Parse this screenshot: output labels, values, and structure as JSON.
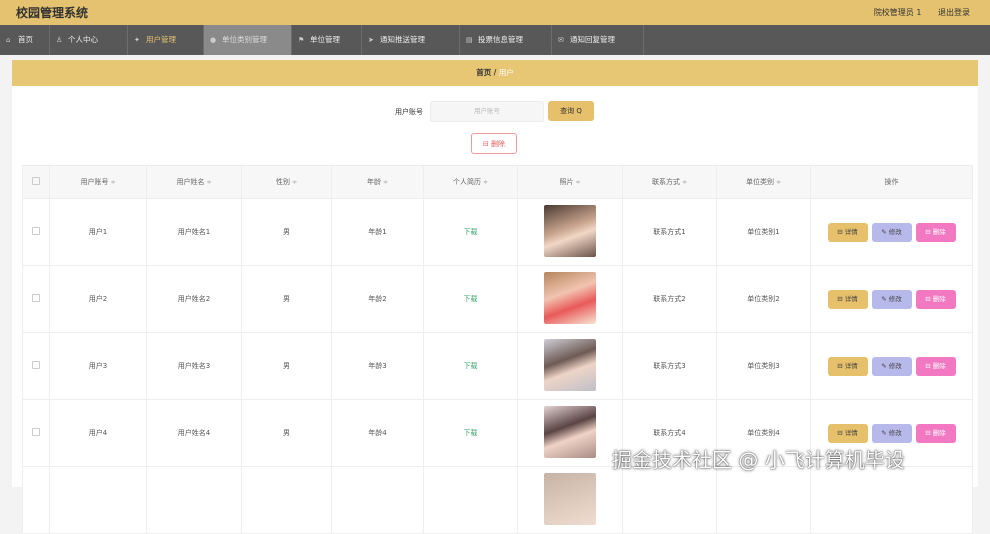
{
  "header": {
    "title": "校园管理系统",
    "user": "院校管理员 1",
    "logout": "退出登录"
  },
  "nav": [
    {
      "label": "首页",
      "icon": "home-icon"
    },
    {
      "label": "个人中心",
      "icon": "user-icon"
    },
    {
      "label": "用户管理",
      "icon": "pin-icon"
    },
    {
      "label": "单位类别管理",
      "icon": "circle-icon"
    },
    {
      "label": "单位管理",
      "icon": "flag-icon"
    },
    {
      "label": "通知推送管理",
      "icon": "send-icon"
    },
    {
      "label": "投票信息管理",
      "icon": "list-icon"
    },
    {
      "label": "通知回复管理",
      "icon": "mail-icon"
    }
  ],
  "breadcrumb": {
    "home": "首页",
    "sep": "/",
    "current": "用户"
  },
  "search": {
    "label": "用户账号",
    "placeholder": "用户账号",
    "button": "查询 Q"
  },
  "actions": {
    "delete": "⊟ 删除"
  },
  "table": {
    "headers": [
      "用户账号",
      "用户姓名",
      "性别",
      "年龄",
      "个人简历",
      "照片",
      "联系方式",
      "单位类别",
      "操作"
    ],
    "sort_mark": "≑",
    "rows": [
      {
        "account": "用户1",
        "name": "用户姓名1",
        "gender": "男",
        "age": "年龄1",
        "resume": "下载",
        "contact": "联系方式1",
        "unit": "单位类别1"
      },
      {
        "account": "用户2",
        "name": "用户姓名2",
        "gender": "男",
        "age": "年龄2",
        "resume": "下载",
        "contact": "联系方式2",
        "unit": "单位类别2"
      },
      {
        "account": "用户3",
        "name": "用户姓名3",
        "gender": "男",
        "age": "年龄3",
        "resume": "下载",
        "contact": "联系方式3",
        "unit": "单位类别3"
      },
      {
        "account": "用户4",
        "name": "用户姓名4",
        "gender": "男",
        "age": "年龄4",
        "resume": "下载",
        "contact": "联系方式4",
        "unit": "单位类别4"
      }
    ],
    "ops": {
      "detail": "⊟ 详情",
      "edit": "✎ 修改",
      "delete": "⊟ 删除"
    }
  },
  "watermark": "掘金技术社区 @ 小飞计算机毕设"
}
